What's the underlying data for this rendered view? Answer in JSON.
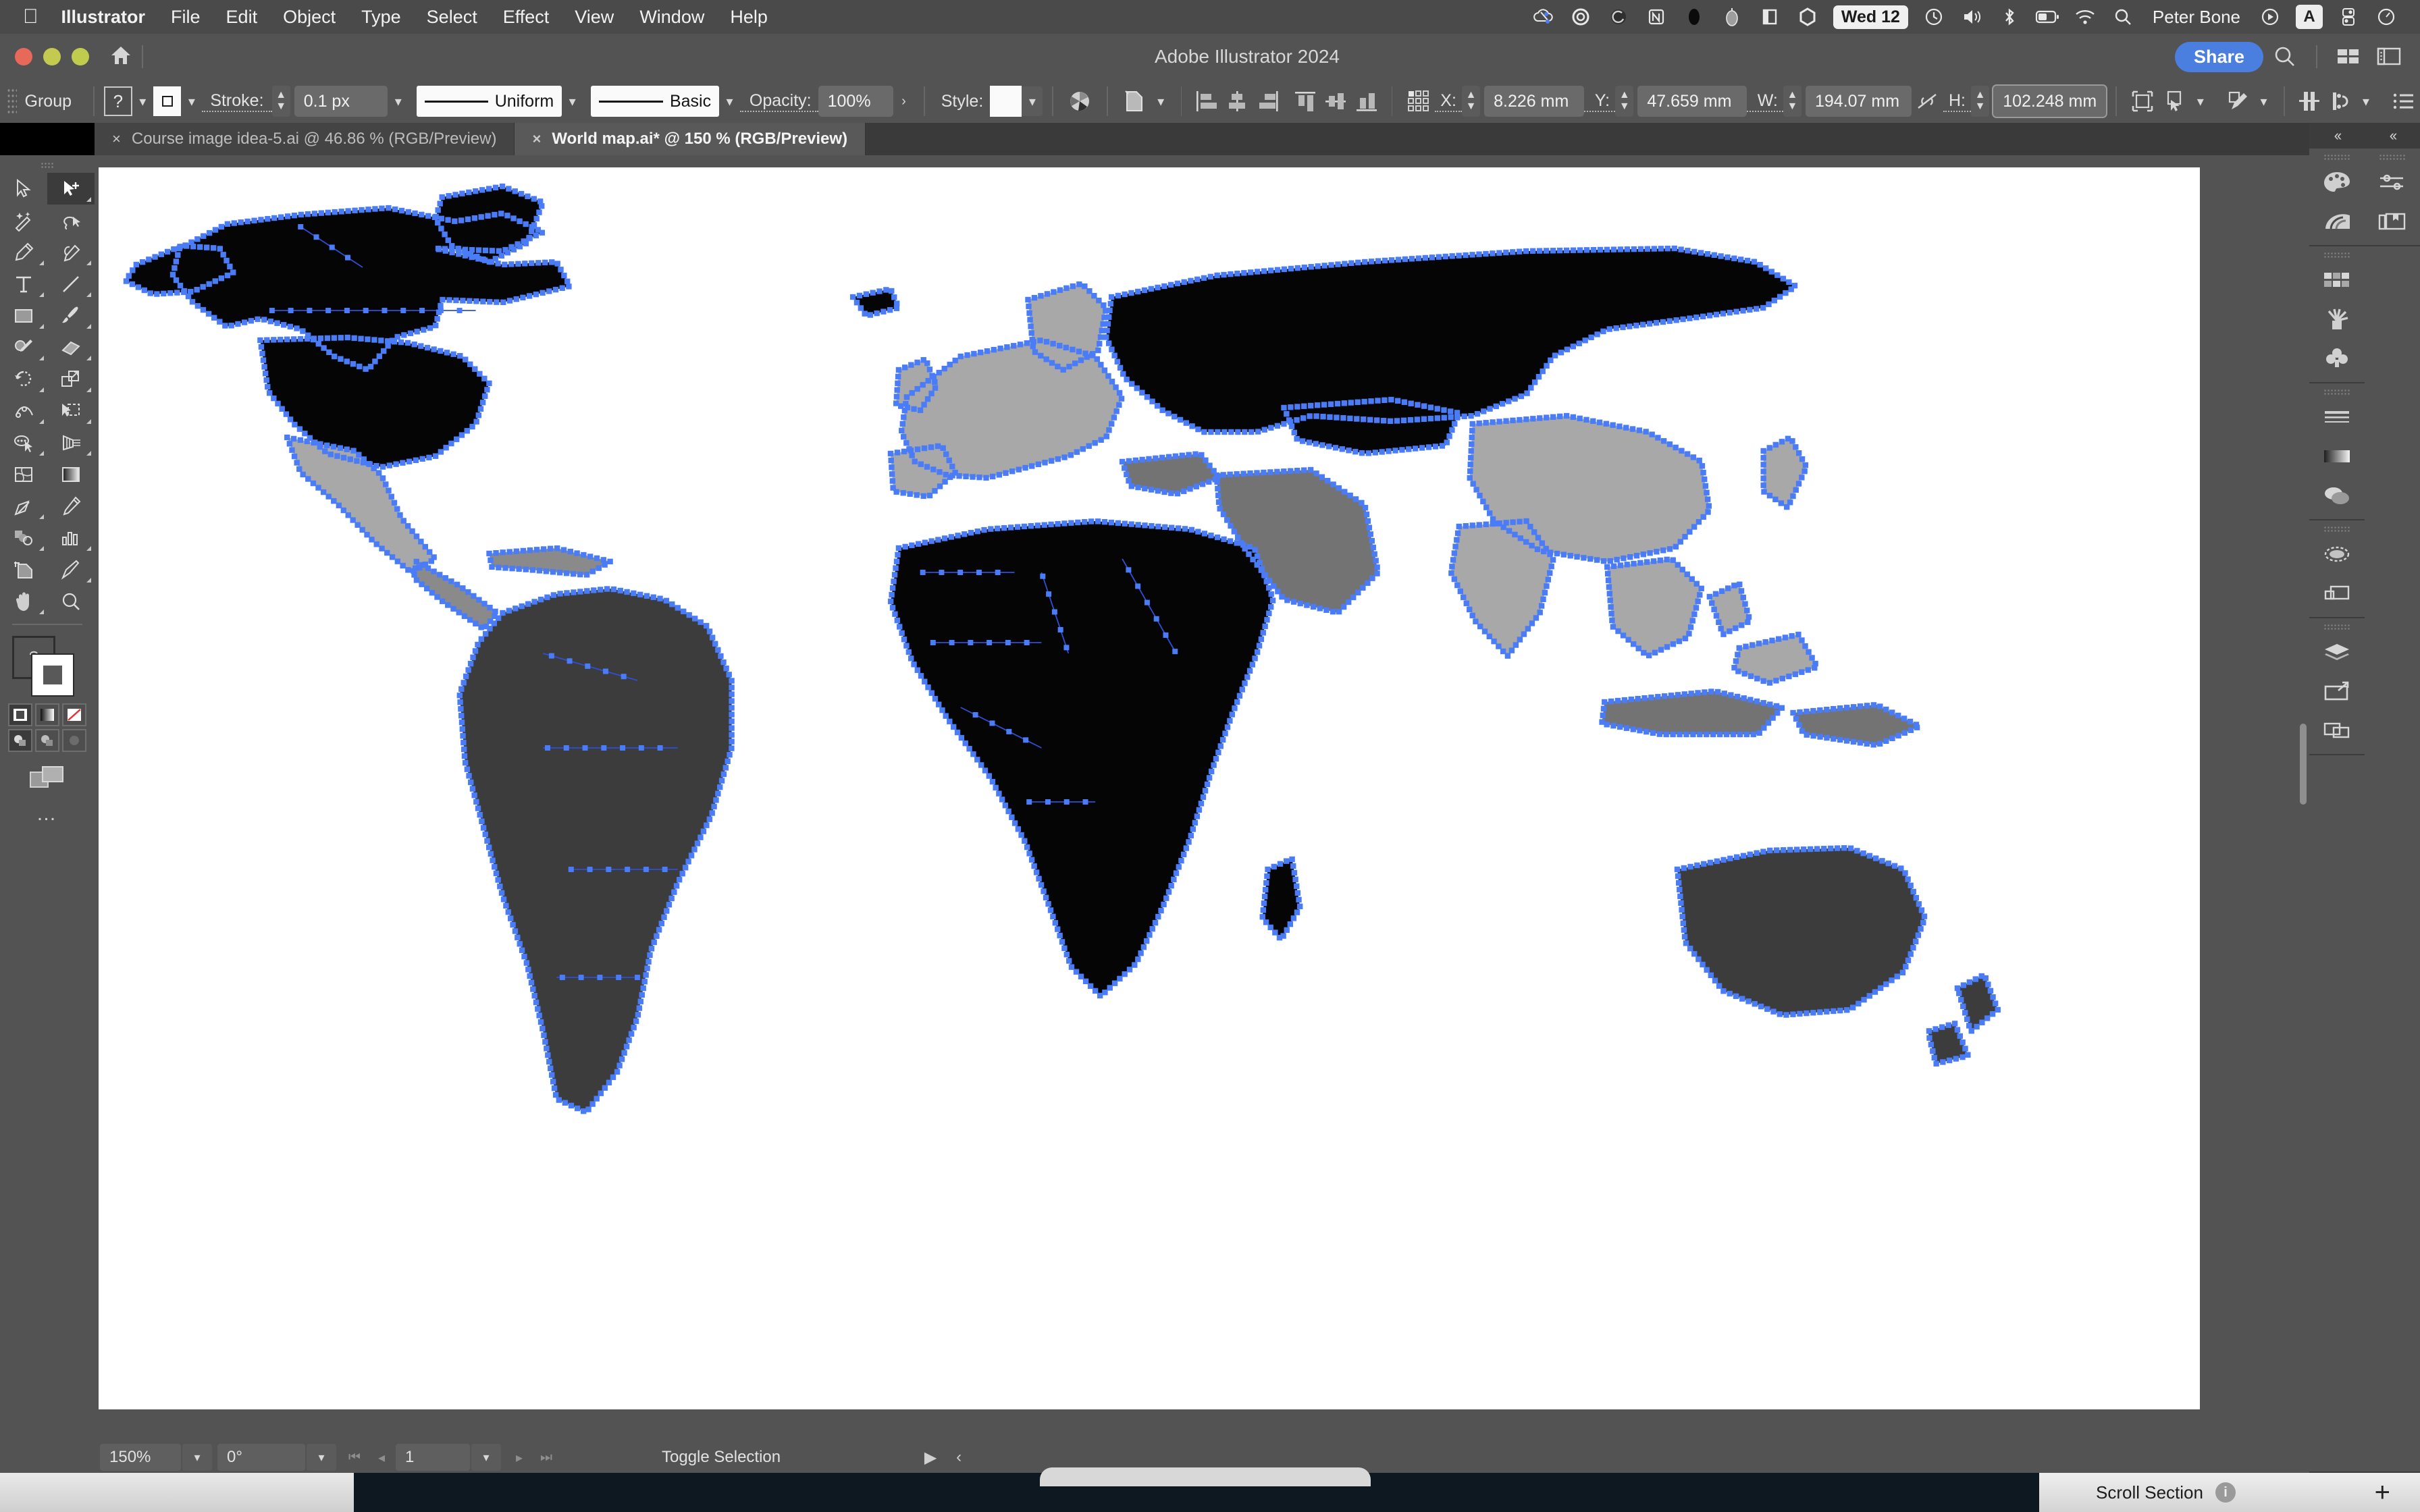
{
  "menubar": {
    "apple_icon": "apple-logo-icon",
    "items": [
      {
        "label": "Illustrator",
        "bold": true
      },
      {
        "label": "File",
        "bold": false
      },
      {
        "label": "Edit",
        "bold": false
      },
      {
        "label": "Object",
        "bold": false
      },
      {
        "label": "Type",
        "bold": false
      },
      {
        "label": "Select",
        "bold": false
      },
      {
        "label": "Effect",
        "bold": false
      },
      {
        "label": "View",
        "bold": false
      },
      {
        "label": "Window",
        "bold": false
      },
      {
        "label": "Help",
        "bold": false
      }
    ],
    "tray_icons": [
      "cloud-sync-icon",
      "circle-ring-icon",
      "spiral-icon",
      "notion-icon",
      "ellipse-black-icon",
      "mouse-icon",
      "panel-split-icon",
      "hexagon-icon"
    ],
    "clock": "Wed 12",
    "tray_icons_right": [
      "time-machine-icon",
      "volume-icon",
      "bluetooth-icon",
      "battery-icon",
      "wifi-icon",
      "search-icon"
    ],
    "user": "Peter Bone",
    "user_trailing_icons": [
      "play-circle-icon"
    ],
    "input_source": "A",
    "tray_icons_end": [
      "control-center-icon",
      "siri-icon"
    ]
  },
  "titlebar": {
    "traffic_lights": [
      "close-button",
      "minimize-button",
      "zoom-button"
    ],
    "home_icon": "home-icon",
    "title": "Adobe Illustrator 2024",
    "share_label": "Share",
    "right_icons": [
      "search-icon",
      "workspace-switcher-icon",
      "panel-layout-icon"
    ]
  },
  "control_bar": {
    "selection_label": "Group",
    "fill_swatch": "?",
    "stroke_swatch_icon": "stroke-square-icon",
    "stroke_label": "Stroke:",
    "stroke_width": "0.1 px",
    "profile_label": "Uniform",
    "brush_label": "Basic",
    "opacity_label": "Opacity:",
    "opacity_value": "100%",
    "style_label": "Style:",
    "icons": [
      "recolor-artwork-icon",
      "select-similar-icon",
      "align-left-icon",
      "align-center-h-icon",
      "align-right-icon",
      "align-top-icon",
      "align-center-v-icon",
      "align-bottom-icon",
      "transform-grid-icon"
    ],
    "x_label": "X:",
    "x_value": "8.226 mm",
    "y_label": "Y:",
    "y_value": "47.659 mm",
    "w_label": "W:",
    "w_value": "194.07 mm",
    "link_icon": "link-broken-icon",
    "h_label": "H:",
    "h_value": "102.248 mm",
    "trailing_icons": [
      "transform-icon",
      "isolate-selection-icon",
      "draw-inside-icon",
      "distribute-spacing-icon",
      "make-clipping-mask-icon",
      "more-options-icon"
    ]
  },
  "tabs": [
    {
      "close": "×",
      "label": "Course image idea-5.ai @ 46.86 % (RGB/Preview)",
      "active": false
    },
    {
      "close": "×",
      "label": "World map.ai* @ 150 % (RGB/Preview)",
      "active": true
    }
  ],
  "toolbar": {
    "tools": [
      [
        "selection-tool",
        "direct-selection-tool"
      ],
      [
        "magic-wand-tool",
        "lasso-tool"
      ],
      [
        "pen-tool",
        "curvature-tool"
      ],
      [
        "type-tool",
        "line-segment-tool"
      ],
      [
        "rectangle-tool",
        "paintbrush-tool"
      ],
      [
        "shaper-tool",
        "eraser-tool"
      ],
      [
        "rotate-tool",
        "scale-tool"
      ],
      [
        "width-tool",
        "free-transform-tool"
      ],
      [
        "shape-builder-tool",
        "perspective-grid-tool"
      ],
      [
        "mesh-tool",
        "gradient-tool"
      ],
      [
        "eyedropper-tool",
        "blend-tool"
      ],
      [
        "symbol-sprayer-tool",
        "column-graph-tool"
      ],
      [
        "artboard-tool",
        "slice-tool"
      ],
      [
        "hand-tool",
        "zoom-tool"
      ]
    ],
    "fill_label": "?",
    "swatch_modes": [
      "color-swatch",
      "gradient-swatch",
      "none-swatch"
    ],
    "draw_modes": [
      "draw-normal",
      "draw-behind",
      "draw-inside"
    ],
    "screen_mode": "screen-mode-icon",
    "more": "…"
  },
  "right_dock": {
    "collapse_label": "‹‹",
    "groups_left": [
      [
        "color-panel-icon",
        "color-guide-icon"
      ],
      [
        "swatches-panel-icon",
        "brushes-panel-icon",
        "symbols-panel-icon"
      ],
      [
        "stroke-panel-icon",
        "gradient-panel-icon",
        "transparency-panel-icon"
      ],
      [
        "appearance-panel-icon",
        "graphic-styles-panel-icon"
      ],
      [
        "layers-panel-icon",
        "artboards-panel-icon",
        "asset-export-panel-icon"
      ]
    ],
    "groups_right": [
      [
        "properties-panel-icon",
        "libraries-panel-icon"
      ]
    ]
  },
  "statusbar": {
    "zoom": "150%",
    "rotation": "0°",
    "page": "1",
    "nav_icons": [
      "first-page-icon",
      "prev-page-icon",
      "next-page-icon",
      "last-page-icon"
    ],
    "status_text": "Toggle Selection",
    "arrow_right": "▶",
    "arrow_left": "‹"
  },
  "mac_dock": {
    "scroll_section_label": "Scroll Section",
    "info_icon": "info-icon",
    "plus_icon": "plus-icon"
  },
  "artwork": {
    "name": "world-map-artwork",
    "selection_color": "#4a7cf7",
    "fills": {
      "black": "#050505",
      "dark_gray": "#3c3c3c",
      "mid_gray": "#737373",
      "light_gray": "#a8a8a8",
      "white": "#ffffff"
    }
  }
}
